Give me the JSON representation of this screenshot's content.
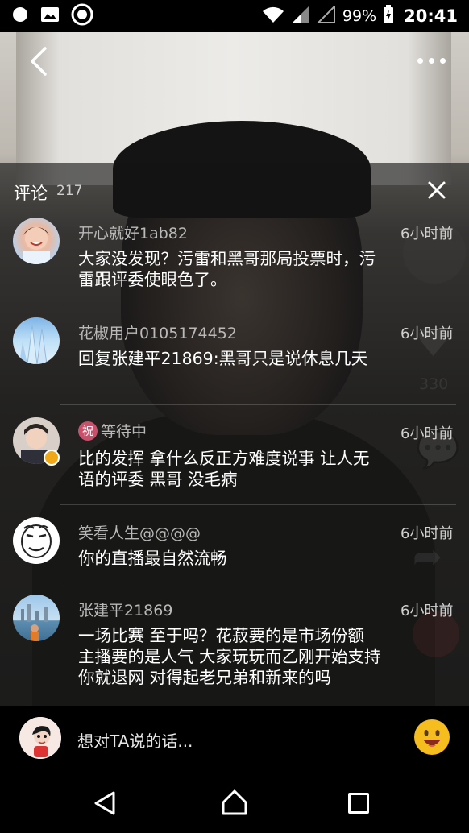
{
  "status_bar": {
    "icons": [
      "record-icon",
      "image-icon",
      "target-icon",
      "wifi-icon",
      "signal-icon",
      "no-signal-icon",
      "battery-charging-icon"
    ],
    "battery": "99%",
    "time": "20:41"
  },
  "header": {
    "back_icon": "chevron-left-icon",
    "more_icon": "more-dots-icon"
  },
  "side_actions": {
    "like_count": "330"
  },
  "comments_panel": {
    "title": "评论",
    "count": "217",
    "close_icon": "close-icon",
    "comments": [
      {
        "user": "开心就好1ab82",
        "time": "6小时前",
        "text": "大家没发现？污雷和黑哥那局投票时，污雷跟评委使眼色了。"
      },
      {
        "user": "花椒用户0105174452",
        "time": "6小时前",
        "text": "回复张建平21869:黑哥只是说休息几天"
      },
      {
        "user": "等待中",
        "badge": "祝",
        "time": "6小时前",
        "text": "比的发挥 拿什么反正方难度说事 让人无语的评委 黑哥 没毛病"
      },
      {
        "user": "笑看人生@@@@",
        "time": "6小时前",
        "text": "你的直播最自然流畅"
      },
      {
        "user": "张建平21869",
        "time": "6小时前",
        "text": "一场比赛 至于吗？花菽要的是市场份额 主播要的是人气 大家玩玩而乙刚开始支持你就退网 对得起老兄弟和新来的吗"
      }
    ]
  },
  "input_bar": {
    "placeholder": "想对TA说的话...",
    "emoji_icon": "smiley-icon"
  },
  "nav_bar": {
    "icons": [
      "nav-back-icon",
      "nav-home-icon",
      "nav-recent-icon"
    ]
  }
}
